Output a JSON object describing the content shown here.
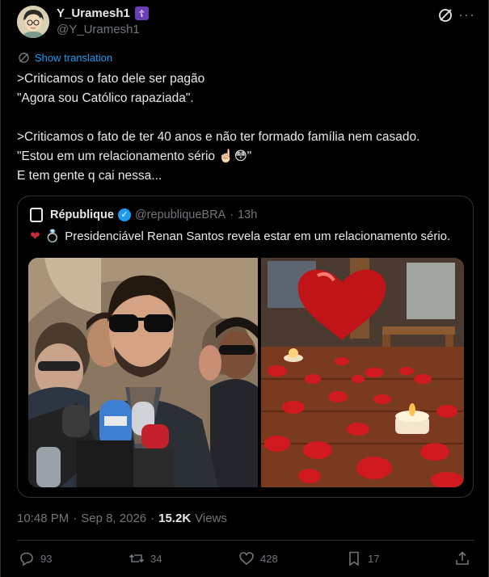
{
  "author": {
    "display_name": "Y_Uramesh1",
    "badge": "☦",
    "handle": "@Y_Uramesh1",
    "avatar_icon": "avatar-icon"
  },
  "translate_label": "Show translation",
  "tweet_text": ">Criticamos o fato dele ser pagão\n\"Agora sou Católico rapaziada\".\n\n>Criticamos o fato de ter 40 anos e não ter formado família nem casado.\n\"Estou em um relacionamento sério ☝🏻😳\"\nE tem gente q cai nessa...",
  "quote": {
    "name": "République",
    "handle": "@republiqueBRA",
    "separator": "·",
    "time": "13h",
    "text": "Presidenciável Renan Santos revela estar em um relacionamento sério.",
    "emoji_heart": "❤",
    "emoji_ring": "💍"
  },
  "meta": {
    "time": "10:48 PM",
    "dot1": "·",
    "date": "Sep 8, 2026",
    "dot2": "·",
    "views_count": "15.2K",
    "views_label": "Views"
  },
  "actions": {
    "replies": "93",
    "reposts": "34",
    "likes": "428",
    "bookmarks": "17"
  },
  "colors": {
    "background": "#000000",
    "text": "#e7e9ea",
    "muted": "#71767b",
    "accent": "#1d9bf0",
    "border": "#2f3336"
  }
}
